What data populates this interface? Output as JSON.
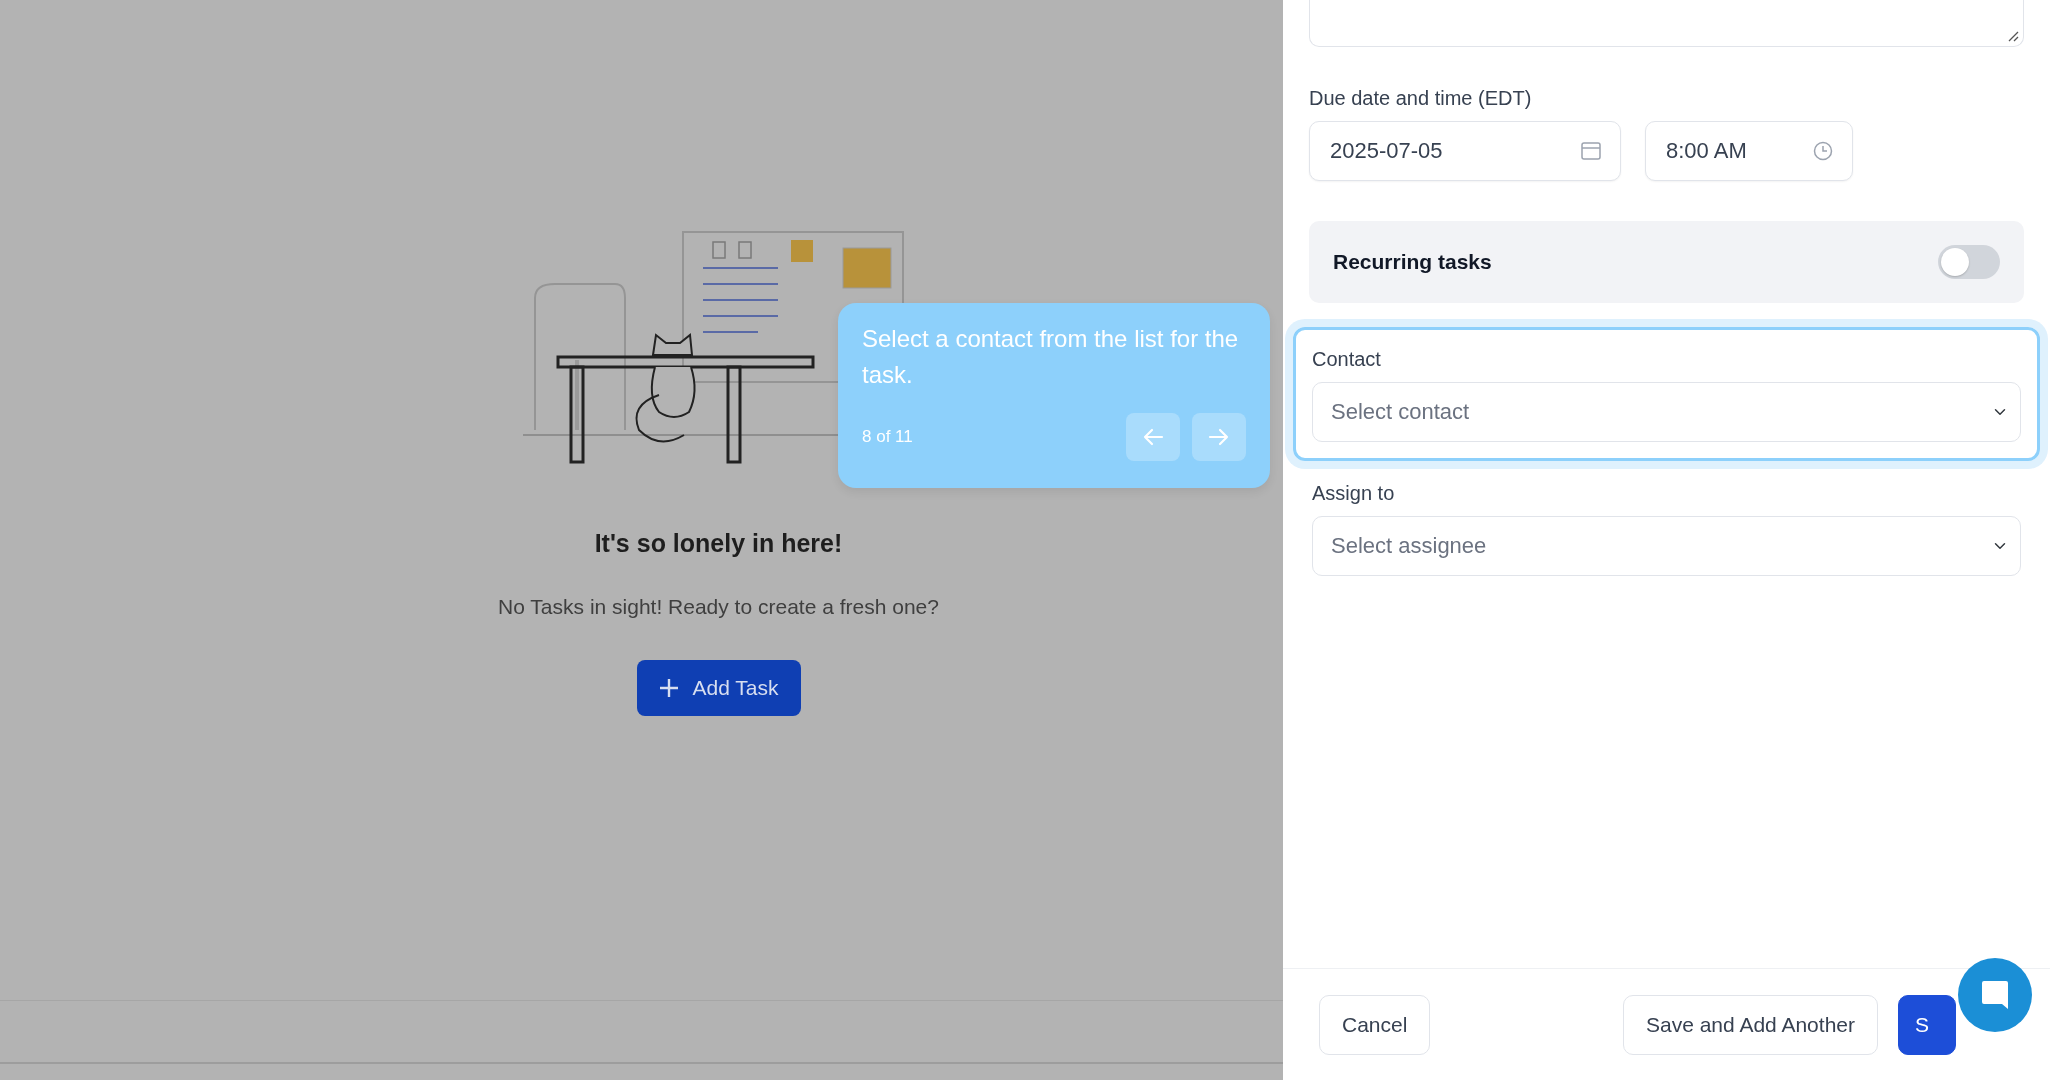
{
  "empty_state": {
    "title": "It's so lonely in here!",
    "message": "No Tasks in sight! Ready to create a fresh one?",
    "button": "Add Task"
  },
  "tour_tooltip": {
    "text": "Select a contact from the list for the task.",
    "step": "8 of 11"
  },
  "form": {
    "due_label": "Due date and time (EDT)",
    "date": "2025-07-05",
    "time": "8:00 AM",
    "recurring": {
      "label": "Recurring tasks",
      "on": false
    },
    "fields": [
      {
        "label": "Contact",
        "placeholder": "Select contact",
        "highlighted": true
      },
      {
        "label": "Assign to",
        "placeholder": "Select assignee",
        "highlighted": false
      }
    ]
  },
  "footer": {
    "buttons": [
      {
        "label": "Cancel",
        "kind": "secondary"
      },
      {
        "label": "Save and Add Another",
        "kind": "secondary"
      },
      {
        "label": "S",
        "kind": "primary"
      }
    ]
  }
}
